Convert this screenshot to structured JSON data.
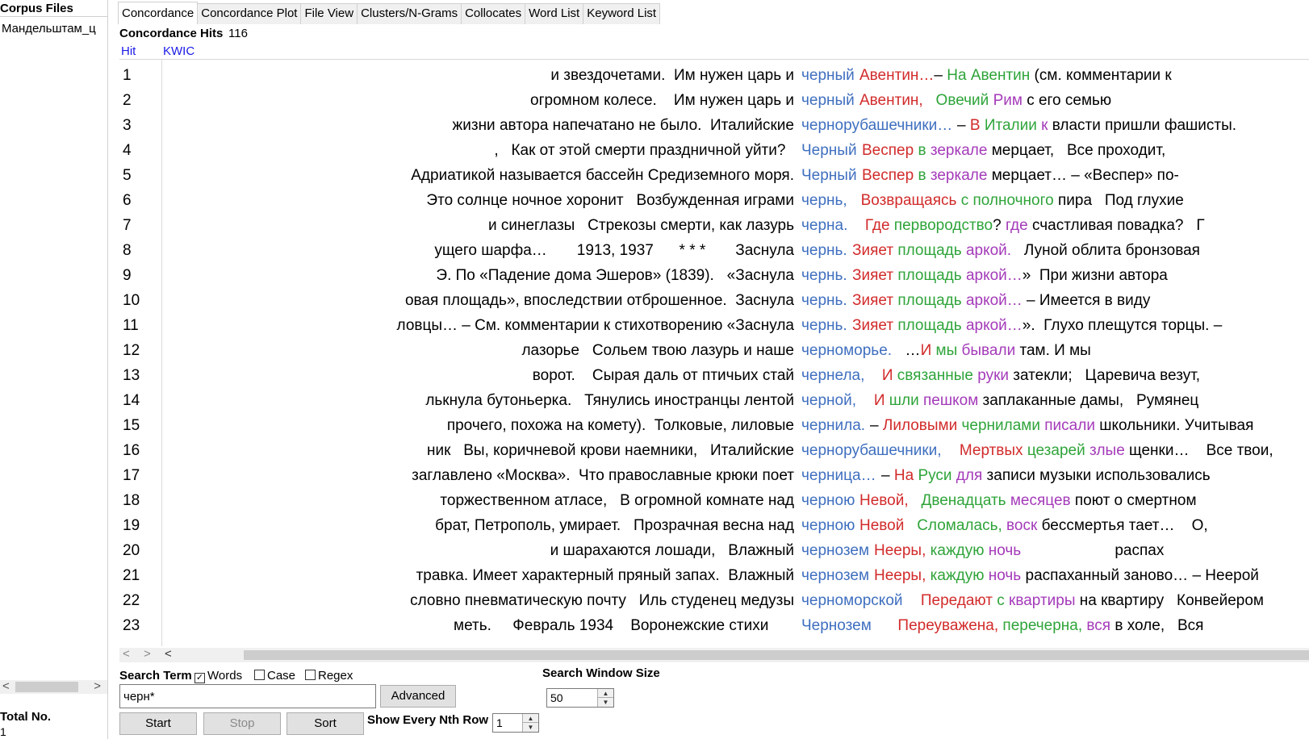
{
  "sidebar": {
    "title": "Corpus Files",
    "files": [
      "Мандельштам_ц"
    ],
    "total_label": "Total No.",
    "total_value": "1"
  },
  "tabs": [
    {
      "label": "Concordance",
      "active": true
    },
    {
      "label": "Concordance Plot",
      "active": false
    },
    {
      "label": "File View",
      "active": false
    },
    {
      "label": "Clusters/N-Grams",
      "active": false
    },
    {
      "label": "Collocates",
      "active": false
    },
    {
      "label": "Word List",
      "active": false
    },
    {
      "label": "Keyword List",
      "active": false
    }
  ],
  "concordance": {
    "hits_label": "Concordance Hits",
    "hits_value": "116",
    "col_hit": "Hit",
    "col_kwic": "KWIC",
    "colors": {
      "keyword": "#3f6fbf",
      "r": "#d22b2b",
      "g": "#2fa43a",
      "p": "#a43ab9"
    },
    "rows": [
      {
        "n": "1",
        "left": "и звездочетами.  Им нужен царь и",
        "kw": "черный",
        "right": [
          [
            "r",
            "Авентин…"
          ],
          [
            "",
            "– "
          ],
          [
            "g",
            "На Авентин"
          ],
          [
            "",
            " (см. комментарии к"
          ]
        ]
      },
      {
        "n": "2",
        "left": "огромном колесе.    Им нужен царь и",
        "kw": "черный",
        "right": [
          [
            "r",
            "Авентин,"
          ],
          [
            "",
            "   "
          ],
          [
            "g",
            "Овечий"
          ],
          [
            "",
            " "
          ],
          [
            "p",
            "Рим"
          ],
          [
            "",
            " с его семью"
          ]
        ]
      },
      {
        "n": "3",
        "left": "жизни автора напечатано не было.  Италийские",
        "kw": "чернорубашечники…",
        "right": [
          [
            "",
            "– "
          ],
          [
            "r",
            "В"
          ],
          [
            "",
            " "
          ],
          [
            "g",
            "Италии"
          ],
          [
            "",
            " "
          ],
          [
            "p",
            "к"
          ],
          [
            "",
            " власти пришли фашисты."
          ]
        ]
      },
      {
        "n": "4",
        "left": ",   Как от этой смерти праздничной уйти?  ",
        "kw": "Черный",
        "right": [
          [
            "r",
            "Веспер"
          ],
          [
            "",
            " "
          ],
          [
            "g",
            "в"
          ],
          [
            "",
            " "
          ],
          [
            "p",
            "зеркале"
          ],
          [
            "",
            " мерцает,   Все проходит,"
          ]
        ]
      },
      {
        "n": "5",
        "left": "Адриатикой называется бассейн Средиземного моря.",
        "kw": "Черный",
        "right": [
          [
            "r",
            "Веспер"
          ],
          [
            "",
            " "
          ],
          [
            "g",
            "в"
          ],
          [
            "",
            " "
          ],
          [
            "p",
            "зеркале"
          ],
          [
            "",
            " мерцает… – «Веспер» по-"
          ]
        ]
      },
      {
        "n": "6",
        "left": "Это солнце ночное хоронит   Возбужденная играми",
        "kw": "чернь,",
        "right": [
          [
            "",
            "  "
          ],
          [
            "r",
            "Возвращаясь"
          ],
          [
            "",
            " "
          ],
          [
            "g",
            "с"
          ],
          [
            "",
            " "
          ],
          [
            "g",
            "полночного"
          ],
          [
            "",
            " пира   Под глухие"
          ]
        ]
      },
      {
        "n": "7",
        "left": "и синеглазы   Стрекозы смерти, как лазурь",
        "kw": "черна.",
        "right": [
          [
            "",
            "   "
          ],
          [
            "r",
            "Где"
          ],
          [
            "",
            " "
          ],
          [
            "g",
            "первородство"
          ],
          [
            "",
            "? "
          ],
          [
            "p",
            "где"
          ],
          [
            "",
            " счастливая повадка?   Г"
          ]
        ]
      },
      {
        "n": "8",
        "left": "ущего шарфа…       1913, 1937      * * *       Заснула",
        "kw": "чернь.",
        "right": [
          [
            "r",
            "Зияет"
          ],
          [
            "",
            " "
          ],
          [
            "g",
            "площадь"
          ],
          [
            "",
            " "
          ],
          [
            "p",
            "аркой."
          ],
          [
            "",
            "   Луной облита бронзовая"
          ]
        ]
      },
      {
        "n": "9",
        "left": "Э. По «Падение дома Эшеров» (1839).   «Заснула",
        "kw": "чернь.",
        "right": [
          [
            "r",
            "Зияет"
          ],
          [
            "",
            " "
          ],
          [
            "g",
            "площадь"
          ],
          [
            "",
            " "
          ],
          [
            "p",
            "аркой…"
          ],
          [
            "",
            "»  При жизни автора"
          ]
        ]
      },
      {
        "n": "10",
        "left": "овая площадь», впоследствии отброшенное.  Заснула",
        "kw": "чернь.",
        "right": [
          [
            "r",
            "Зияет"
          ],
          [
            "",
            " "
          ],
          [
            "g",
            "площадь"
          ],
          [
            "",
            " "
          ],
          [
            "p",
            "аркой…"
          ],
          [
            "",
            " – Имеется в виду"
          ]
        ]
      },
      {
        "n": "11",
        "left": "ловцы… – См. комментарии к стихотворению «Заснула",
        "kw": "чернь.",
        "right": [
          [
            "r",
            "Зияет"
          ],
          [
            "",
            " "
          ],
          [
            "g",
            "площадь"
          ],
          [
            "",
            " "
          ],
          [
            "p",
            "аркой…"
          ],
          [
            "",
            "».  Глухо плещутся торцы. –"
          ]
        ]
      },
      {
        "n": "12",
        "left": "лазорье   Сольем твою лазурь и наше",
        "kw": "черноморье.",
        "right": [
          [
            "",
            "  …"
          ],
          [
            "r",
            "И"
          ],
          [
            "",
            " "
          ],
          [
            "g",
            "мы"
          ],
          [
            "",
            " "
          ],
          [
            "p",
            "бывали"
          ],
          [
            "",
            " там. И мы"
          ]
        ]
      },
      {
        "n": "13",
        "left": "ворот.    Сырая даль от птичьих стай",
        "kw": "чернела,",
        "right": [
          [
            "",
            "   "
          ],
          [
            "r",
            "И"
          ],
          [
            "",
            " "
          ],
          [
            "g",
            "связанные"
          ],
          [
            "",
            " "
          ],
          [
            "p",
            "руки"
          ],
          [
            "",
            " затекли;   Царевича везут,"
          ]
        ]
      },
      {
        "n": "14",
        "left": "лькнула бутоньерка.   Тянулись иностранцы лентой",
        "kw": "черной,",
        "right": [
          [
            "",
            "   "
          ],
          [
            "r",
            "И"
          ],
          [
            "",
            " "
          ],
          [
            "g",
            "шли"
          ],
          [
            "",
            " "
          ],
          [
            "p",
            "пешком"
          ],
          [
            "",
            " заплаканные дамы,   Румянец"
          ]
        ]
      },
      {
        "n": "15",
        "left": "прочего, похожа на комету).  Толковые, лиловые",
        "kw": "чернила.",
        "right": [
          [
            "",
            "– "
          ],
          [
            "r",
            "Лиловыми"
          ],
          [
            "",
            " "
          ],
          [
            "g",
            "чернилами"
          ],
          [
            "",
            " "
          ],
          [
            "p",
            "писали"
          ],
          [
            "",
            " школьники. Учитывая"
          ]
        ]
      },
      {
        "n": "16",
        "left": "ник   Вы, коричневой крови наемники,   Италийские",
        "kw": "чернорубашечники,",
        "right": [
          [
            "",
            "   "
          ],
          [
            "r",
            "Мертвых"
          ],
          [
            "",
            " "
          ],
          [
            "g",
            "цезарей"
          ],
          [
            "",
            " "
          ],
          [
            "p",
            "злые"
          ],
          [
            "",
            " щенки…    Все твои,"
          ]
        ]
      },
      {
        "n": "17",
        "left": "заглавлено «Москва».  Что православные крюки поет",
        "kw": "черница…",
        "right": [
          [
            "",
            "– "
          ],
          [
            "r",
            "На"
          ],
          [
            "",
            " "
          ],
          [
            "g",
            "Руси"
          ],
          [
            "",
            " "
          ],
          [
            "p",
            "для"
          ],
          [
            "",
            " записи музыки использовались"
          ]
        ]
      },
      {
        "n": "18",
        "left": "торжественном атласе,   В огромной комнате над",
        "kw": "черною",
        "right": [
          [
            "r",
            "Невой,"
          ],
          [
            "",
            "   "
          ],
          [
            "g",
            "Двенадцать"
          ],
          [
            "",
            " "
          ],
          [
            "p",
            "месяцев"
          ],
          [
            "",
            " поют о смертном"
          ]
        ]
      },
      {
        "n": "19",
        "left": "брат, Петрополь, умирает.   Прозрачная весна над",
        "kw": "черною",
        "right": [
          [
            "r",
            "Невой"
          ],
          [
            "",
            "   "
          ],
          [
            "g",
            "Сломалась,"
          ],
          [
            "",
            " "
          ],
          [
            "p",
            "воск"
          ],
          [
            "",
            " бессмертья тает…    О,"
          ]
        ]
      },
      {
        "n": "20",
        "left": "и шарахаются лошади,   Влажный",
        "kw": "чернозем",
        "right": [
          [
            "r",
            "Нееры,"
          ],
          [
            "",
            " "
          ],
          [
            "g",
            "каждую"
          ],
          [
            "",
            " "
          ],
          [
            "p",
            "ночь"
          ],
          [
            "",
            "                      распах"
          ]
        ]
      },
      {
        "n": "21",
        "left": "травка. Имеет характерный пряный запах.  Влажный",
        "kw": "чернозем",
        "right": [
          [
            "r",
            "Нееры,"
          ],
          [
            "",
            " "
          ],
          [
            "g",
            "каждую"
          ],
          [
            "",
            " "
          ],
          [
            "p",
            "ночь"
          ],
          [
            "",
            " распаханный заново… – Неерой"
          ]
        ]
      },
      {
        "n": "22",
        "left": "словно пневматическую почту   Иль студенец медузы",
        "kw": "черноморской",
        "right": [
          [
            "",
            "   "
          ],
          [
            "r",
            "Передают"
          ],
          [
            "",
            " "
          ],
          [
            "g",
            "с"
          ],
          [
            "",
            " "
          ],
          [
            "p",
            "квартиры"
          ],
          [
            "",
            " на квартиру   Конвейером"
          ]
        ]
      },
      {
        "n": "23",
        "left": "меть.     Февраль 1934    Воронежские стихи      ",
        "kw": "Чернозем",
        "right": [
          [
            "",
            "     "
          ],
          [
            "r",
            "Переуважена,"
          ],
          [
            "",
            " "
          ],
          [
            "g",
            "перечерна,"
          ],
          [
            "",
            " "
          ],
          [
            "p",
            "вся"
          ],
          [
            "",
            " в холе,   Вся"
          ]
        ]
      }
    ]
  },
  "search": {
    "label": "Search Term",
    "words_label": "Words",
    "words_checked": true,
    "case_label": "Case",
    "case_checked": false,
    "regex_label": "Regex",
    "regex_checked": false,
    "value": "черн*",
    "advanced_label": "Advanced",
    "start_label": "Start",
    "stop_label": "Stop",
    "sort_label": "Sort",
    "nth_label": "Show Every Nth Row",
    "nth_value": "1",
    "window_label": "Search Window Size",
    "window_value": "50"
  },
  "icons": {
    "scroll_left": "chevron-left-icon",
    "scroll_right": "chevron-right-icon",
    "spin_up": "triangle-up-icon",
    "spin_down": "triangle-down-icon"
  }
}
